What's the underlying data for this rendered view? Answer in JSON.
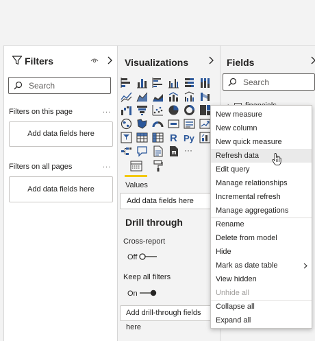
{
  "filters": {
    "title": "Filters",
    "search_placeholder": "Search",
    "on_this_page": {
      "label": "Filters on this page",
      "drop_text": "Add data fields here"
    },
    "on_all_pages": {
      "label": "Filters on all pages",
      "drop_text": "Add data fields here"
    },
    "more": "..."
  },
  "visualizations": {
    "title": "Visualizations",
    "icon_names": [
      "stacked-bar-icon",
      "stacked-column-icon",
      "clustered-bar-icon",
      "clustered-column-icon",
      "100-stacked-bar-icon",
      "100-stacked-column-icon",
      "line-chart-icon",
      "area-chart-icon",
      "stacked-area-icon",
      "line-column-icon",
      "line-clustered-column-icon",
      "ribbon-chart-icon",
      "waterfall-icon",
      "funnel-chart-icon",
      "scatter-icon",
      "pie-chart-icon",
      "donut-chart-icon",
      "treemap-icon",
      "map-icon",
      "filled-map-icon",
      "gauge-icon",
      "card-icon",
      "multi-row-card-icon",
      "kpi-icon",
      "slicer-icon",
      "table-icon",
      "matrix-icon",
      "r-visual-icon",
      "python-visual-icon",
      "key-influencers-icon",
      "decomposition-tree-icon",
      "qa-icon",
      "smart-narrative-icon",
      "paginated-report-icon",
      "more-visuals-icon"
    ],
    "r_glyph": "R",
    "py_glyph": "Py",
    "more_glyph": "···",
    "values_label": "Values",
    "values_drop": "Add data fields here",
    "drill_through": "Drill through",
    "cross_report": "Cross-report",
    "cross_report_state": "Off",
    "keep_all_filters": "Keep all filters",
    "keep_all_filters_state": "On",
    "drill_drop": "Add drill-through fields here"
  },
  "fields": {
    "title": "Fields",
    "search_placeholder": "Search",
    "table_name": "financials"
  },
  "context_menu": {
    "items": [
      {
        "label": "New measure",
        "state": "normal"
      },
      {
        "label": "New column",
        "state": "normal"
      },
      {
        "label": "New quick measure",
        "state": "normal"
      },
      {
        "label": "Refresh data",
        "state": "hover"
      },
      {
        "label": "Edit query",
        "state": "normal"
      },
      {
        "label": "Manage relationships",
        "state": "normal"
      },
      {
        "label": "Incremental refresh",
        "state": "normal"
      },
      {
        "label": "Manage aggregations",
        "state": "normal"
      },
      {
        "label": "Rename",
        "state": "normal"
      },
      {
        "label": "Delete from model",
        "state": "normal"
      },
      {
        "label": "Hide",
        "state": "normal"
      },
      {
        "label": "Mark as date table",
        "state": "submenu"
      },
      {
        "label": "View hidden",
        "state": "normal"
      },
      {
        "label": "Unhide all",
        "state": "disabled"
      },
      {
        "label": "Collapse all",
        "state": "normal"
      },
      {
        "label": "Expand all",
        "state": "normal"
      }
    ]
  },
  "colors": {
    "accent_yellow": "#f2c811",
    "icon_blue": "#2b579a",
    "icon_dark": "#3b3a39"
  }
}
